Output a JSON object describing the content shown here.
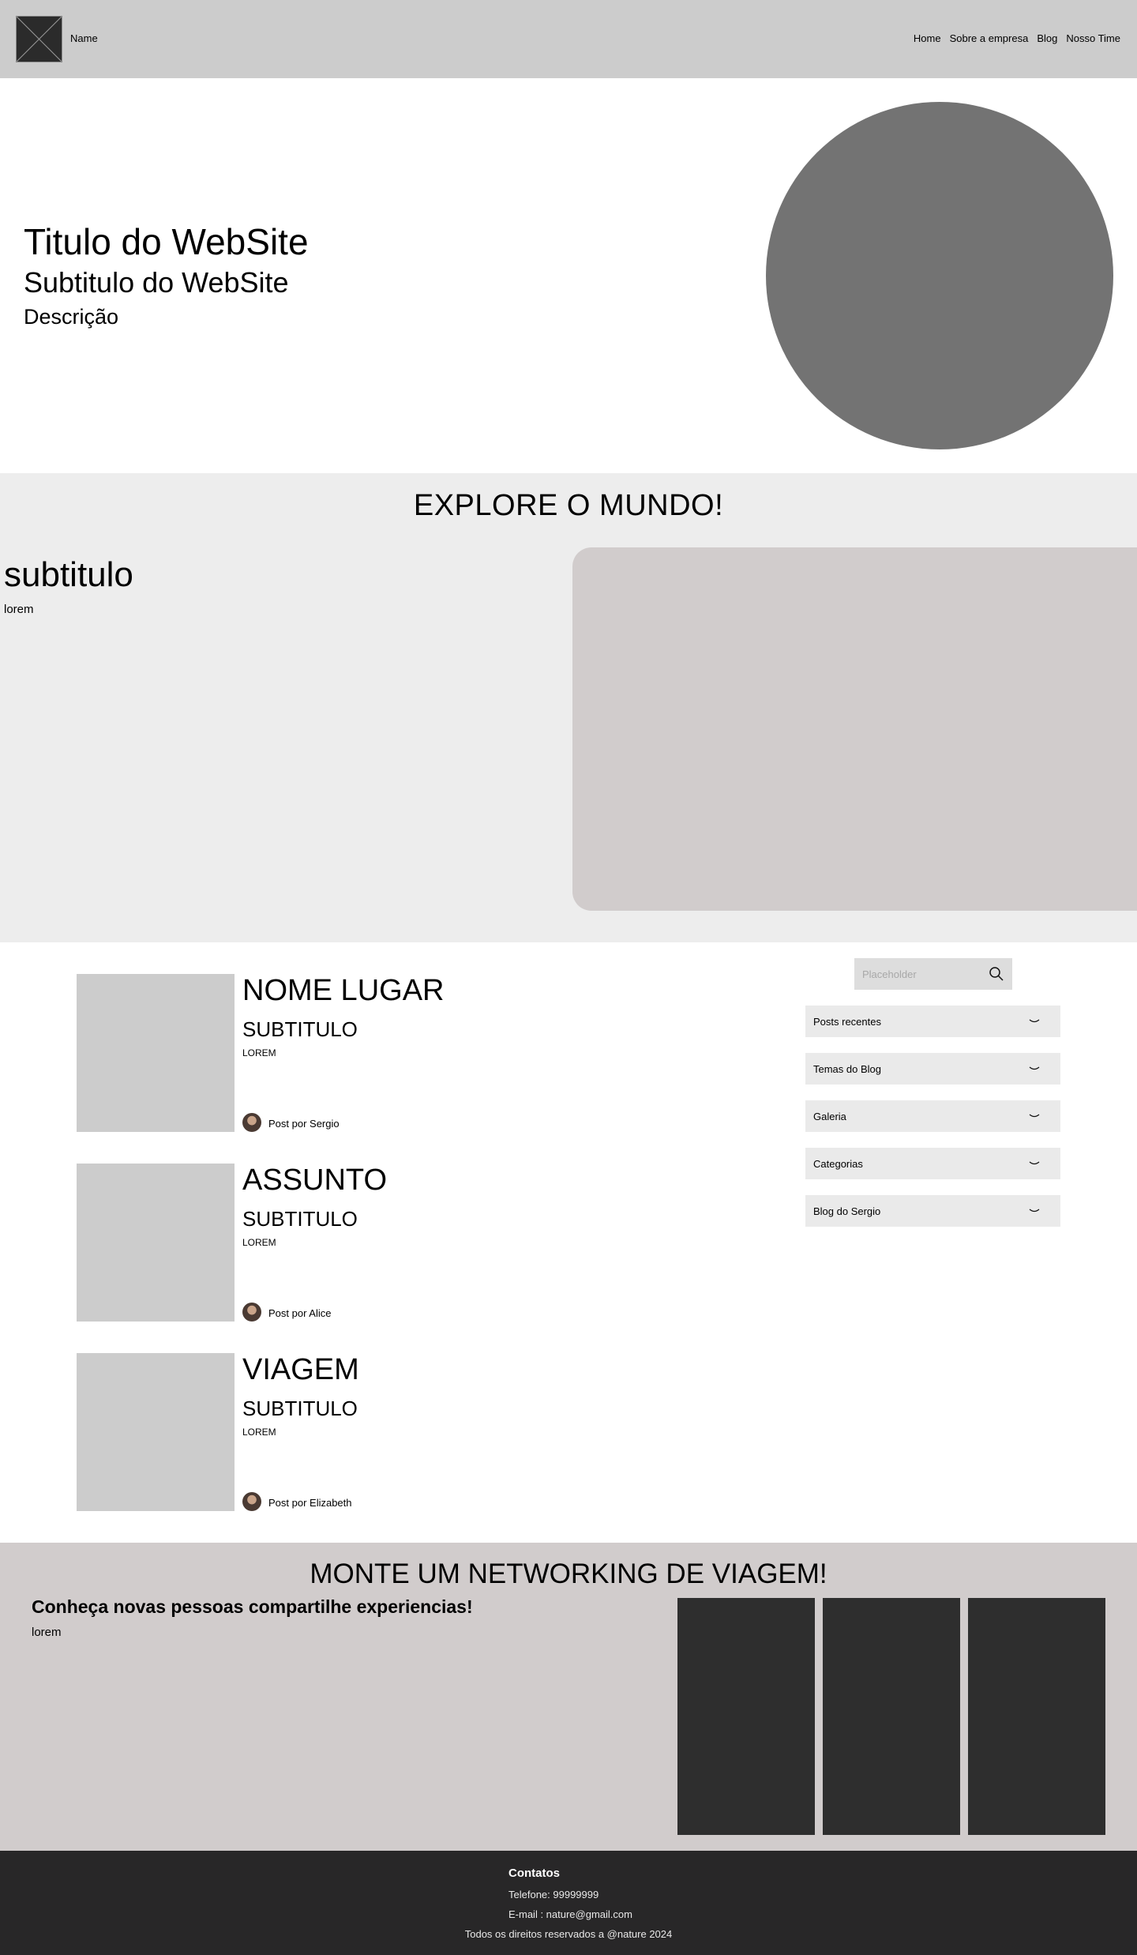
{
  "header": {
    "logo_icon": "image-placeholder-icon",
    "brand": "Name",
    "nav": [
      "Home",
      "Sobre a empresa",
      "Blog",
      "Nosso Time"
    ]
  },
  "hero": {
    "title": "Titulo do WebSite",
    "subtitle": "Subtitulo do WebSite",
    "description": "Descrição"
  },
  "explore": {
    "title": "EXPLORE O MUNDO!",
    "subtitle": "subtitulo",
    "text": "lorem"
  },
  "posts": [
    {
      "title": "NOME LUGAR",
      "subtitle": "SUBTITULO",
      "text": "LOREM",
      "author": "Post por Sergio"
    },
    {
      "title": "ASSUNTO",
      "subtitle": "SUBTITULO",
      "text": "LOREM",
      "author": "Post por Alice"
    },
    {
      "title": "VIAGEM",
      "subtitle": "SUBTITULO",
      "text": "LOREM",
      "author": "Post por Elizabeth"
    }
  ],
  "sidebar": {
    "search_placeholder": "Placeholder",
    "search_icon": "search-icon",
    "items": [
      "Posts recentes",
      "Temas do Blog",
      "Galeria",
      "Categorias",
      "Blog do Sergio"
    ],
    "chevron_icon": "chevron-down-icon"
  },
  "network": {
    "title": "MONTE UM NETWORKING DE VIAGEM!",
    "subtitle": "Conheça novas pessoas compartilhe experiencias!",
    "text": "lorem"
  },
  "footer": {
    "title": "Contatos",
    "phone": "Telefone:  99999999",
    "email": "E-mail : nature@gmail.com",
    "copyright": "Todos os direitos reservados a @nature 2024"
  },
  "colors": {
    "header_bg": "#cccccc",
    "hero_circle": "#737373",
    "explore_bg": "#ededed",
    "explore_image": "#d1cccc",
    "network_bg": "#d1cccc",
    "card": "#2e2e2e",
    "footer_bg": "#282728"
  }
}
